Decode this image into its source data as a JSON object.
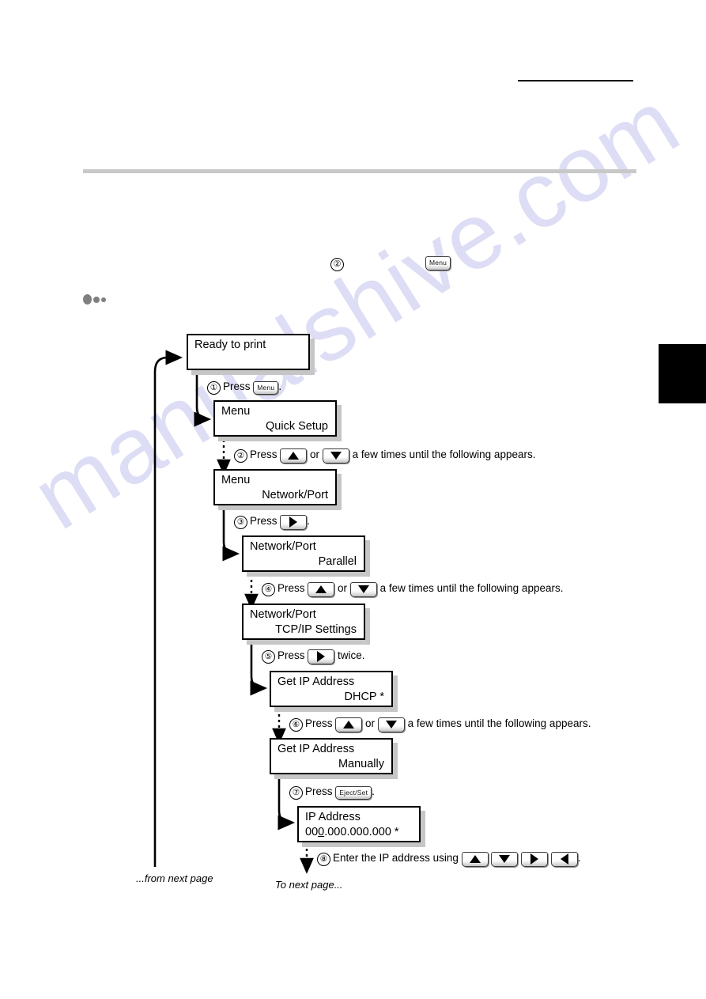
{
  "document": {
    "watermark": "manualshive.com",
    "from_prev_caption": "...from next page",
    "to_next_caption": "To next page..."
  },
  "top_note": {
    "circled_number": "②",
    "key_label": "Menu"
  },
  "flow": {
    "screens": [
      {
        "id": "ready",
        "line1": "Ready to print",
        "line2": ""
      },
      {
        "id": "menu-quick",
        "line1": "Menu",
        "line2": "Quick Setup"
      },
      {
        "id": "menu-network",
        "line1": "Menu",
        "line2": "Network/Port"
      },
      {
        "id": "np-parallel",
        "line1": "Network/Port",
        "line2": "Parallel"
      },
      {
        "id": "np-tcpip",
        "line1": "Network/Port",
        "line2": "TCP/IP Settings"
      },
      {
        "id": "ip-dhcp",
        "line1": "Get IP Address",
        "line2": "DHCP *"
      },
      {
        "id": "ip-manual",
        "line1": "Get IP Address",
        "line2": "Manually"
      },
      {
        "id": "ip-value",
        "line1": "IP Address",
        "line2_pre": "00",
        "line2_cursor": "0",
        "line2_post": ".000.000.000 *"
      }
    ],
    "steps": [
      {
        "num": "①",
        "pre": "Press",
        "keys": [
          {
            "type": "named",
            "label": "Menu"
          }
        ],
        "post": "."
      },
      {
        "num": "②",
        "pre": "Press",
        "keys": [
          {
            "type": "arrow",
            "dir": "up"
          },
          {
            "type": "arrow",
            "dir": "down"
          }
        ],
        "joiner": "or",
        "post": "a few times until the following appears."
      },
      {
        "num": "③",
        "pre": "Press",
        "keys": [
          {
            "type": "arrow",
            "dir": "right"
          }
        ],
        "post": "."
      },
      {
        "num": "④",
        "pre": "Press",
        "keys": [
          {
            "type": "arrow",
            "dir": "up"
          },
          {
            "type": "arrow",
            "dir": "down"
          }
        ],
        "joiner": "or",
        "post": "a few times until the following appears."
      },
      {
        "num": "⑤",
        "pre": "Press",
        "keys": [
          {
            "type": "arrow",
            "dir": "right"
          }
        ],
        "post": "twice."
      },
      {
        "num": "⑥",
        "pre": "Press",
        "keys": [
          {
            "type": "arrow",
            "dir": "up"
          },
          {
            "type": "arrow",
            "dir": "down"
          }
        ],
        "joiner": "or",
        "post": "a few times until the following appears."
      },
      {
        "num": "⑦",
        "pre": "Press",
        "keys": [
          {
            "type": "named",
            "label": "Eject/Set"
          }
        ],
        "post": "."
      },
      {
        "num": "⑧",
        "pre": "Enter the IP address using",
        "keys": [
          {
            "type": "arrow",
            "dir": "up"
          },
          {
            "type": "arrow",
            "dir": "down"
          },
          {
            "type": "arrow",
            "dir": "right"
          },
          {
            "type": "arrow",
            "dir": "left"
          }
        ],
        "post": "."
      }
    ]
  },
  "colors": {
    "shadow": "#c6c6c6",
    "band": "#c8c8c8",
    "watermark": "#c9c9ef",
    "tab": "#000000"
  }
}
